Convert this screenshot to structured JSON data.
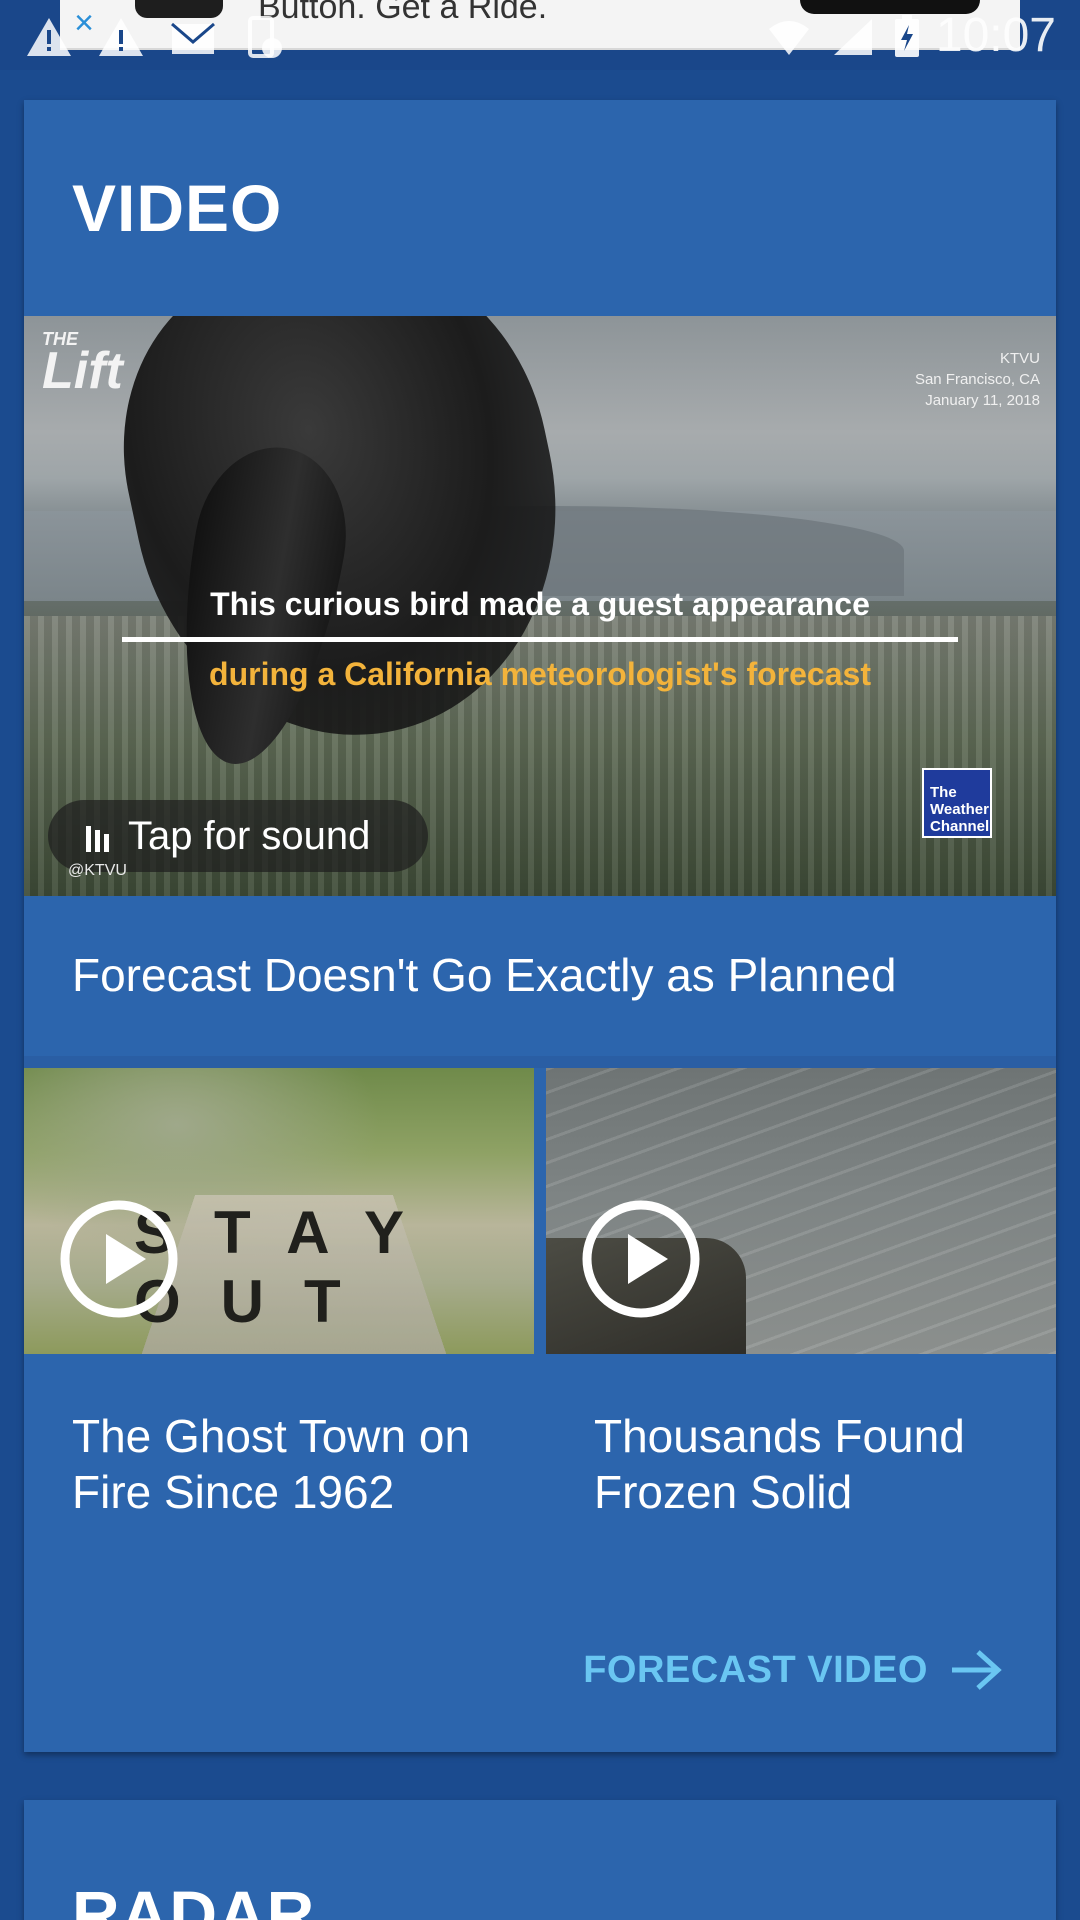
{
  "status_bar": {
    "time": "10:07",
    "ad_text": "Button. Get a Ride."
  },
  "video_section": {
    "title": "VIDEO",
    "hero": {
      "logo_small": "THE",
      "logo_large": "Lift",
      "source_lines": [
        "KTVU",
        "San Francisco, CA",
        "January 11, 2018"
      ],
      "caption_line1": "This curious bird made a guest appearance",
      "caption_line2": "during a California meteorologist's forecast",
      "network_logo": "The Weather Channel",
      "watermark": "@KTVU",
      "sound_label": "Tap for sound",
      "title": "Forecast Doesn't Go Exactly as Planned"
    },
    "tiles": [
      {
        "image_text": "STAY OUT",
        "title": "The Ghost Town on Fire Since 1962"
      },
      {
        "title": "Thousands Found Frozen Solid"
      }
    ],
    "link_label": "FORECAST VIDEO"
  },
  "radar_section": {
    "title": "RADAR"
  },
  "colors": {
    "background": "#1b4b8f",
    "card": "#2c65ad",
    "accent_link": "#6ac6f2",
    "caption_highlight": "#f3b33b"
  }
}
